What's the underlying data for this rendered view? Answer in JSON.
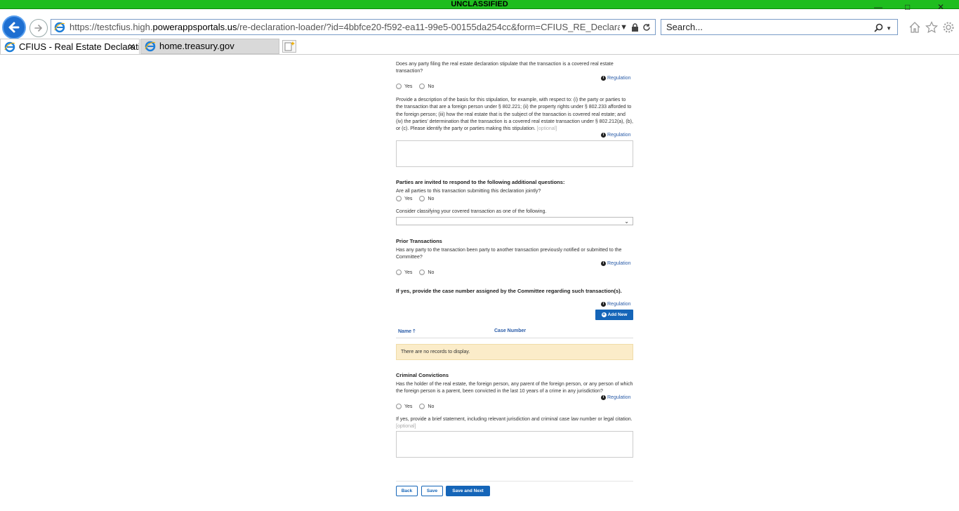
{
  "banner": {
    "text": "UNCLASSIFIED"
  },
  "window": {
    "minimize": "—",
    "maximize": "□",
    "close": "✕"
  },
  "browser": {
    "url_prefix": "https://testcfius.high.",
    "url_domain": "powerappsportals.us",
    "url_rest": "/re-declaration-loader/?id=4bbfce20-f592-ea11-99e5-00155da254cc&form=CFIUS_RE_Declaration_Gen_De",
    "search_placeholder": "Search...",
    "tabs": [
      {
        "label": "CFIUS - Real Estate Declarati...",
        "close": "✕"
      },
      {
        "label": "home.treasury.gov"
      }
    ]
  },
  "form": {
    "q1": "Does any party filing the real estate declaration stipulate that the transaction is a covered real estate transaction?",
    "regulation": "Regulation",
    "yes": "Yes",
    "no": "No",
    "q2": "Provide a description of the basis for this stipulation, for example, with respect to: (i) the party or parties to the transaction that are a foreign person under § 802.221; (ii) the property rights under § 802.233 afforded to the foreign person; (iii) how the real estate that is the subject of the transaction is covered real estate; and (iv) the parties' determination that the transaction is a covered real estate transaction under § 802.212(a), (b), or (c). Please identify the party or parties making this stipulation.",
    "optional": "[optional]",
    "additional_heading": "Parties are invited to respond to the following additional questions:",
    "q3": "Are all parties to this transaction submitting this declaration jointly?",
    "q4": "Consider classifying your covered transaction as one of the following.",
    "prior_heading": "Prior Transactions",
    "q5": "Has any party to the transaction been party to another transaction previously notified or submitted to the Committee?",
    "case_heading": "If yes, provide the case number assigned by the Committee regarding such transaction(s).",
    "add_new": "Add New",
    "col_name": "Name",
    "col_case": "Case Number",
    "no_records": "There are no records to display.",
    "criminal_heading": "Criminal Convictions",
    "q6": "Has the holder of the real estate, the foreign person, any parent of the foreign person, or any person of which the foreign person is a parent, been convicted in the last 10 years of a crime in any jurisdiction?",
    "q7": "If yes, provide a brief statement, including relevant jurisdiction and criminal case law number or legal citation.",
    "back": "Back",
    "save": "Save",
    "save_next": "Save and Next"
  }
}
